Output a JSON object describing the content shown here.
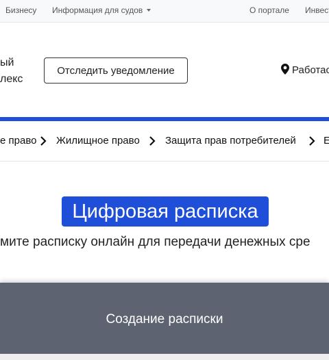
{
  "topbar": {
    "business": "Бизнесу",
    "courts": "Информация для судов",
    "about": "О портале",
    "investors": "Инвест"
  },
  "header": {
    "brand_line1": "ый",
    "brand_line2": "лекс",
    "track_button": "Отследить уведомление",
    "status": "Работас"
  },
  "categories": [
    {
      "label": "е право"
    },
    {
      "label": "Жилищное право"
    },
    {
      "label": "Защита прав потребителей"
    },
    {
      "label": "Е"
    }
  ],
  "hero": {
    "title": "Цифровая расписка",
    "subtitle": "мите расписку онлайн для передачи денежных сре"
  },
  "band": {
    "label": "Создание расписки"
  },
  "colors": {
    "accent": "#1f4fd8",
    "band": "#5d6370"
  }
}
